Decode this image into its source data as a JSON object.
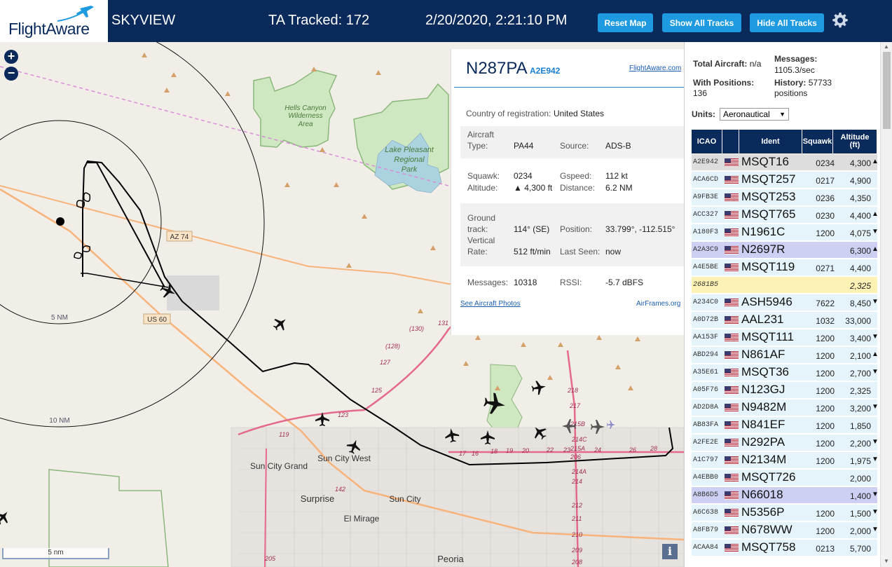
{
  "header": {
    "logo_text": "FlightAware",
    "app_title": "SKYVIEW",
    "tracked_label": "TA Tracked: 172",
    "datetime": "2/20/2020, 2:21:10 PM",
    "buttons": {
      "reset": "Reset Map",
      "show_all": "Show All Tracks",
      "hide_all": "Hide All Tracks"
    },
    "gear_icon": "gear-icon"
  },
  "map": {
    "zoom_in": "+",
    "zoom_out": "−",
    "scale_label": "5 nm",
    "info_label": "i",
    "range_rings": [
      "5 NM",
      "10 NM"
    ],
    "road_labels": [
      "AZ 74",
      "US 60"
    ],
    "area_labels": [
      "Hells Canyon Wilderness Area",
      "Lake Pleasant Regional Park"
    ],
    "town_labels": [
      "Sun City Grand",
      "Sun City West",
      "Sun City",
      "Surprise",
      "El Mirage",
      "Peoria"
    ],
    "route_numbers": [
      "(130)",
      "131",
      "(128)",
      "127",
      "125",
      "123",
      "119",
      "142",
      "17",
      "16",
      "18",
      "19",
      "20",
      "22",
      "23",
      "24",
      "26",
      "28",
      "218",
      "217",
      "215B",
      "215A",
      "214C",
      "214A",
      "214",
      "212",
      "211",
      "210",
      "209",
      "208",
      "206",
      "205"
    ],
    "colors": {
      "land": "#f1eee8",
      "water": "#aad3df",
      "park": "#cfe8c1",
      "park_border": "#8ab77a",
      "primary_road": "#f7b37a",
      "motorway": "#e46a8a",
      "track": "#000000"
    }
  },
  "popup": {
    "registration": "N287PA",
    "hex": "A2E942",
    "fa_link": "FlightAware.com",
    "country_label": "Country of registration:",
    "country_value": "United States",
    "aircraft_type_label": "Aircraft Type:",
    "aircraft_type_label_1": "Aircraft",
    "aircraft_type_label_2": "Type:",
    "aircraft_type_value": "PA44",
    "source_label": "Source:",
    "source_value": "ADS-B",
    "squawk_label": "Squawk:",
    "squawk_value": "0234",
    "gspeed_label": "Gspeed:",
    "gspeed_value": "112 kt",
    "altitude_label": "Altitude:",
    "altitude_value": "▲ 4,300 ft",
    "distance_label": "Distance:",
    "distance_value": "6.2 NM",
    "ground_track_label_1": "Ground",
    "ground_track_label_2": "track:",
    "ground_track_value": "114° (SE)",
    "position_label": "Position:",
    "position_value": "33.799°, -112.515°",
    "vrate_label_1": "Vertical",
    "vrate_label_2": "Rate:",
    "vrate_value": "512 ft/min",
    "last_seen_label": "Last Seen:",
    "last_seen_value": "now",
    "messages_label": "Messages:",
    "messages_value": "10318",
    "rssi_label": "RSSI:",
    "rssi_value": "-5.7 dBFS",
    "photos_link": "See Aircraft Photos",
    "airframes_link": "AirFrames.org"
  },
  "sidebar": {
    "total_aircraft_label": "Total Aircraft:",
    "total_aircraft_value": "n/a",
    "messages_label": "Messages:",
    "messages_value": "1105.3/sec",
    "with_positions_label": "With Positions:",
    "with_positions_value": "136",
    "history_label": "History:",
    "history_value": "57733",
    "history_unit": "positions",
    "units_label": "Units:",
    "units_value": "Aeronautical",
    "columns": [
      "ICAO",
      "",
      "Ident",
      "Squawk",
      "Altitude (ft)"
    ],
    "col_alt_1": "Altitude",
    "col_alt_2": "(ft)",
    "rows": [
      {
        "icao": "A2E942",
        "ident": "MSQT16",
        "squawk": "0234",
        "alt": "4,300",
        "trend": "▲",
        "style": "sel",
        "flag": true
      },
      {
        "icao": "ACA6CD",
        "ident": "MSQT257",
        "squawk": "0217",
        "alt": "4,900",
        "trend": "",
        "style": "",
        "flag": true
      },
      {
        "icao": "A9FB3E",
        "ident": "MSQT253",
        "squawk": "0236",
        "alt": "4,350",
        "trend": "",
        "style": "",
        "flag": true
      },
      {
        "icao": "ACC327",
        "ident": "MSQT765",
        "squawk": "0230",
        "alt": "4,400",
        "trend": "▲",
        "style": "",
        "flag": true
      },
      {
        "icao": "A180F3",
        "ident": "N1961C",
        "squawk": "1200",
        "alt": "4,075",
        "trend": "▼",
        "style": "",
        "flag": true
      },
      {
        "icao": "A2A3C9",
        "ident": "N2697R",
        "squawk": "",
        "alt": "6,300",
        "trend": "▲",
        "style": "purple",
        "flag": true
      },
      {
        "icao": "A4E5BE",
        "ident": "MSQT119",
        "squawk": "0271",
        "alt": "4,400",
        "trend": "",
        "style": "",
        "flag": true
      },
      {
        "icao": "2681B5",
        "ident": "",
        "squawk": "",
        "alt": "2,325",
        "trend": "",
        "style": "yellow",
        "flag": false
      },
      {
        "icao": "A234C0",
        "ident": "ASH5946",
        "squawk": "7622",
        "alt": "8,450",
        "trend": "▼",
        "style": "",
        "flag": true
      },
      {
        "icao": "A0D72B",
        "ident": "AAL231",
        "squawk": "1032",
        "alt": "33,000",
        "trend": "",
        "style": "",
        "flag": true
      },
      {
        "icao": "AA153F",
        "ident": "MSQT111",
        "squawk": "1200",
        "alt": "3,400",
        "trend": "▼",
        "style": "",
        "flag": true
      },
      {
        "icao": "ABD294",
        "ident": "N861AF",
        "squawk": "1200",
        "alt": "2,100",
        "trend": "▲",
        "style": "",
        "flag": true
      },
      {
        "icao": "A35E61",
        "ident": "MSQT36",
        "squawk": "1200",
        "alt": "2,700",
        "trend": "▼",
        "style": "",
        "flag": true
      },
      {
        "icao": "A05F76",
        "ident": "N123GJ",
        "squawk": "1200",
        "alt": "2,325",
        "trend": "",
        "style": "",
        "flag": true
      },
      {
        "icao": "AD2D8A",
        "ident": "N9482M",
        "squawk": "1200",
        "alt": "3,200",
        "trend": "▼",
        "style": "",
        "flag": true
      },
      {
        "icao": "AB83FA",
        "ident": "N841EF",
        "squawk": "1200",
        "alt": "1,850",
        "trend": "",
        "style": "",
        "flag": true
      },
      {
        "icao": "A2FE2E",
        "ident": "N292PA",
        "squawk": "1200",
        "alt": "2,200",
        "trend": "▼",
        "style": "",
        "flag": true
      },
      {
        "icao": "A1C797",
        "ident": "N2134M",
        "squawk": "1200",
        "alt": "1,975",
        "trend": "▼",
        "style": "",
        "flag": true
      },
      {
        "icao": "A4EBB0",
        "ident": "MSQT726",
        "squawk": "",
        "alt": "2,000",
        "trend": "",
        "style": "",
        "flag": true
      },
      {
        "icao": "A8B6D5",
        "ident": "N66018",
        "squawk": "",
        "alt": "1,400",
        "trend": "▼",
        "style": "purple",
        "flag": true
      },
      {
        "icao": "A6C638",
        "ident": "N5356P",
        "squawk": "1200",
        "alt": "1,500",
        "trend": "▼",
        "style": "",
        "flag": true
      },
      {
        "icao": "A8FB79",
        "ident": "N678WW",
        "squawk": "1200",
        "alt": "2,000",
        "trend": "▼",
        "style": "",
        "flag": true
      },
      {
        "icao": "ACAA84",
        "ident": "MSQT758",
        "squawk": "0213",
        "alt": "5,700",
        "trend": "",
        "style": "",
        "flag": true
      }
    ]
  }
}
